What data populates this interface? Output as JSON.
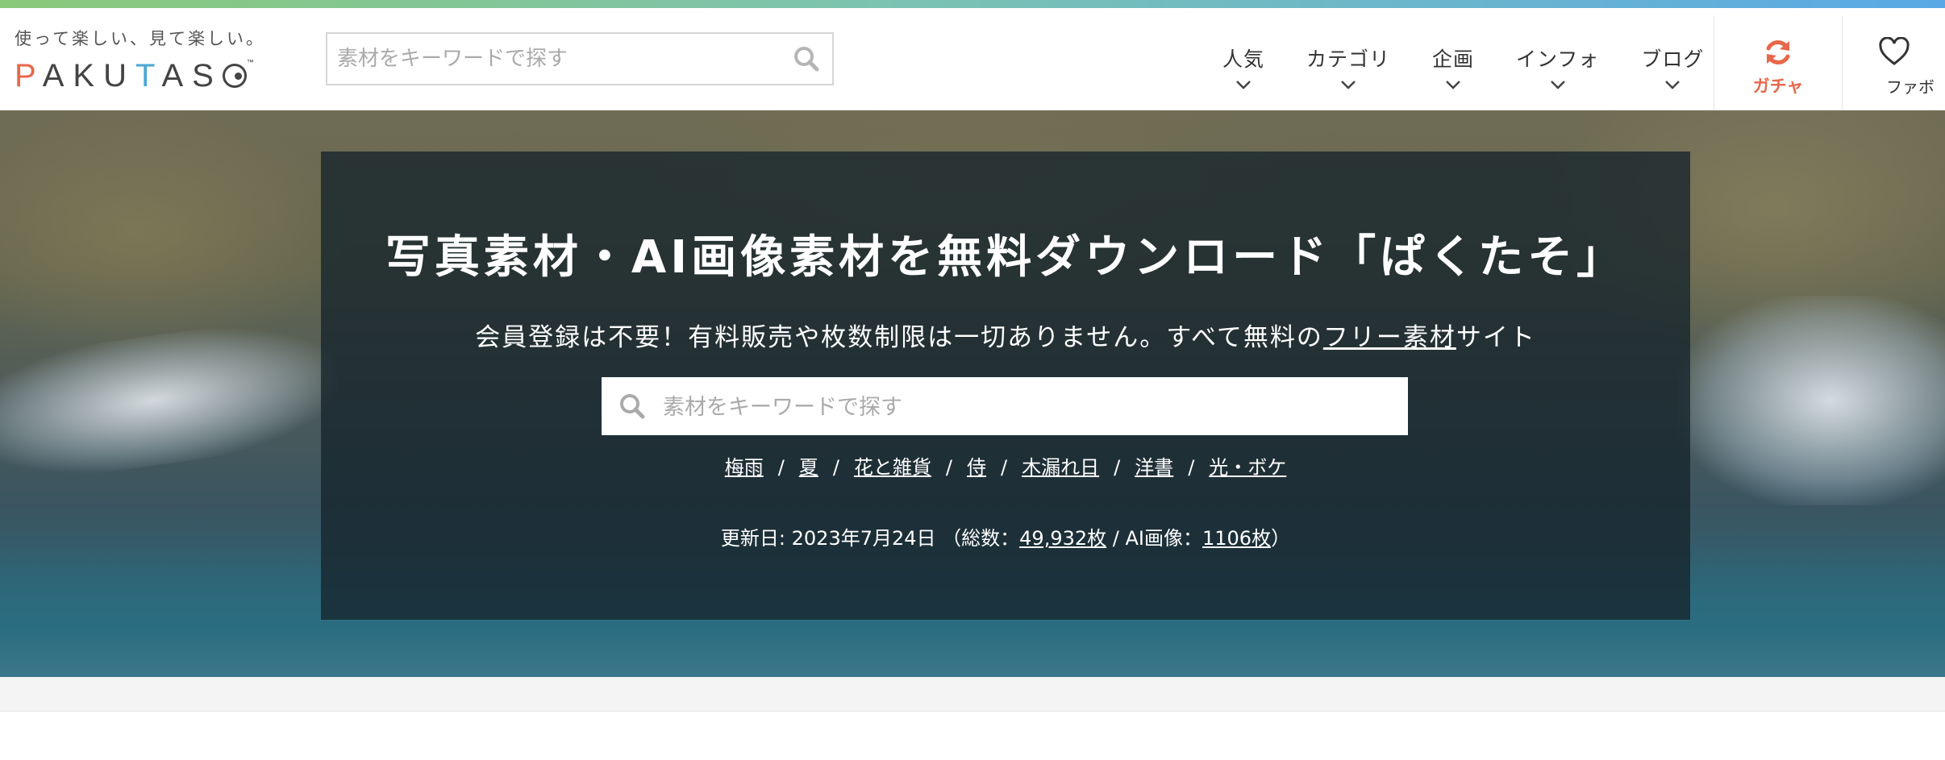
{
  "header": {
    "tagline": "使って楽しい、見て楽しい。",
    "logo": {
      "p": "P",
      "aku": "AKU",
      "t": "T",
      "as": "AS",
      "tm": "™"
    },
    "search_placeholder": "素材をキーワードで探す",
    "nav": [
      {
        "label": "人気"
      },
      {
        "label": "カテゴリ"
      },
      {
        "label": "企画"
      },
      {
        "label": "インフォ"
      },
      {
        "label": "ブログ"
      }
    ],
    "gacha_label": "ガチャ",
    "favorite_label": "ファボ"
  },
  "hero": {
    "title": "写真素材・AI画像素材を無料ダウンロード「ぱくたそ」",
    "subtitle_before": "会員登録は不要！有料販売や枚数制限は一切ありません。すべて無料の",
    "subtitle_link": "フリー素材",
    "subtitle_after": "サイト",
    "search_placeholder": "素材をキーワードで探す",
    "tags": [
      "梅雨",
      "夏",
      "花と雑貨",
      "侍",
      "木漏れ日",
      "洋書",
      "光・ボケ"
    ],
    "tag_separator": "/",
    "updated_prefix": "更新日: 2023年7月24日 （総数：",
    "total_count": "49,932枚",
    "ai_prefix": " / AI画像：",
    "ai_count": "1106枚",
    "updated_suffix": "）"
  },
  "colors": {
    "accent_orange": "#e7674b",
    "accent_blue": "#4aa7d6"
  }
}
